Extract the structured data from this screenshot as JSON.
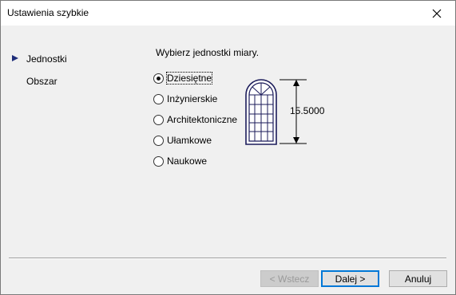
{
  "window": {
    "title": "Ustawienia szybkie"
  },
  "nav": [
    {
      "label": "Jednostki",
      "active": true
    },
    {
      "label": "Obszar",
      "active": false
    }
  ],
  "main": {
    "prompt": "Wybierz jednostki miary.",
    "options": [
      {
        "label": "Dziesiętne",
        "checked": true
      },
      {
        "label": "Inżynierskie",
        "checked": false
      },
      {
        "label": "Architektoniczne",
        "checked": false
      },
      {
        "label": "Ułamkowe",
        "checked": false
      },
      {
        "label": "Naukowe",
        "checked": false
      }
    ],
    "preview_value": "15.5000"
  },
  "buttons": {
    "back": "< Wstecz",
    "next": "Dalej >",
    "cancel": "Anuluj"
  }
}
